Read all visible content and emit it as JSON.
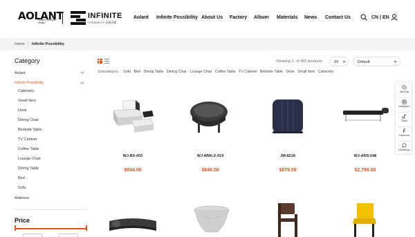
{
  "header": {
    "brand_logo": "AOLANT",
    "brand_tagline": "Modern furniture design",
    "sub_brand": "INFINITE",
    "sub_brand_tagline": "POSSIBILITY 无限可能",
    "nav": [
      "Aolant",
      "Infinite Possibility",
      "About Us",
      "Factory",
      "Album",
      "Materials",
      "News",
      "Contact Us"
    ],
    "lang": "CN | EN",
    "icons": [
      "search-icon",
      "user-icon"
    ]
  },
  "breadcrumb": {
    "home": "Home",
    "sep": "/",
    "current": "Infinite Possibility"
  },
  "sidebar": {
    "title": "Category",
    "items": [
      {
        "label": "Aolant"
      },
      {
        "label": "Infinite Possibility",
        "active": true
      }
    ],
    "sub_items": [
      "Cabinetry",
      "Small Item",
      "Desk",
      "Dining Chair",
      "Bedside Table",
      "TV Cabinet",
      "Coffee Table",
      "Lounge Chair",
      "Dining Table",
      "Bed",
      "Sofa"
    ],
    "after": "Mattress",
    "price_title": "Price"
  },
  "toolbar": {
    "showing": "Showing 1- of 492 products",
    "per_page": "20",
    "sort": "Default",
    "subcategory_label": "Subcategory :",
    "subcategories": [
      "Sofa",
      "Bed",
      "Dining Table",
      "Dining Chair",
      "Lounge Chair",
      "Coffee Table",
      "TV Cabinet",
      "Bedside Table",
      "Desk",
      "Small Item",
      "Cabinetry"
    ]
  },
  "products": [
    {
      "name": "WJ-BX-003",
      "price": "$654.00"
    },
    {
      "name": "WJ-WWLX-019",
      "price": "$846.00"
    },
    {
      "name": "JM-8218",
      "price": "$879.00"
    },
    {
      "name": "WJ-ARS-048",
      "price": "$2,796.00"
    }
  ],
  "social": [
    "WeChat",
    "Instagram",
    "Tiktok",
    "Facebook",
    "WhatsApp"
  ],
  "colors": {
    "accent": "#e4531a",
    "text": "#222222",
    "crumb_bg": "#f4f4f4"
  }
}
